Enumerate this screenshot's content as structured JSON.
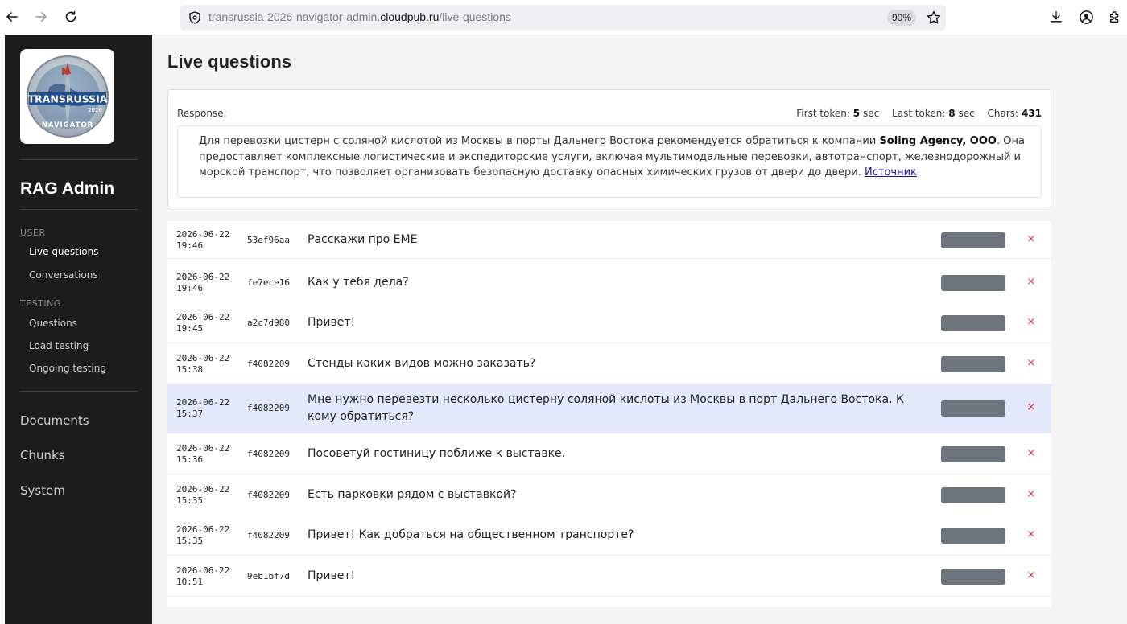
{
  "browser": {
    "url_prefix": "transrussia-2026-navigator-admin.",
    "url_host": "cloudpub.ru",
    "url_path": "/live-questions",
    "zoom": "90%"
  },
  "sidebar": {
    "brand": "RAG Admin",
    "logo_text": {
      "main": "TRANSRUSSIA",
      "year": "2026",
      "sub": "NAVIGATOR",
      "compass": "N"
    },
    "sections": [
      {
        "label": "USER",
        "items": [
          "Live questions",
          "Conversations"
        ]
      },
      {
        "label": "TESTING",
        "items": [
          "Questions",
          "Load testing",
          "Ongoing testing"
        ]
      }
    ],
    "main_items": [
      "Documents",
      "Chunks",
      "System"
    ]
  },
  "main": {
    "title": "Live questions",
    "response": {
      "label": "Response:",
      "first_token_label": "First token:",
      "first_token_value": "5",
      "last_token_label": "Last token:",
      "last_token_value": "8",
      "sec_unit": "sec",
      "chars_label": "Chars:",
      "chars_value": "431",
      "text_before": "Для перевозки цистерн с соляной кислотой из Москвы в порты Дальнего Востока рекомендуется обратиться к компании ",
      "company": "Soling Agency, ООО",
      "text_after": ". Она предоставляет комплексные логистические и экспедиторские услуги, включая мультимодальные перевозки, автотранспорт, железнодорожный и морской транспорт, что позволяет организовать безопасную доставку опасных химических грузов от двери до двери. ",
      "source_link": "Источник"
    },
    "questions": [
      {
        "date": "2026-06-22",
        "time": "19:46",
        "id": "53ef96aa",
        "text": "Расскажи про EME"
      },
      {
        "date": "2026-06-22",
        "time": "19:46",
        "id": "fe7ece16",
        "text": "Как у тебя дела?"
      },
      {
        "date": "2026-06-22",
        "time": "19:45",
        "id": "a2c7d980",
        "text": "Привет!"
      },
      {
        "date": "2026-06-22",
        "time": "15:38",
        "id": "f4082209",
        "text": "Стенды каких видов можно заказать?"
      },
      {
        "date": "2026-06-22",
        "time": "15:37",
        "id": "f4082209",
        "text": "Мне нужно перевезти несколько цистерну соляной кислоты из Москвы в порт Дальнего Востока. К кому обратиться?"
      },
      {
        "date": "2026-06-22",
        "time": "15:36",
        "id": "f4082209",
        "text": "Посоветуй гостиницу поближе к выставке."
      },
      {
        "date": "2026-06-22",
        "time": "15:35",
        "id": "f4082209",
        "text": "Есть парковки рядом с выставкой?"
      },
      {
        "date": "2026-06-22",
        "time": "15:35",
        "id": "f4082209",
        "text": "Привет! Как добраться на общественном транспорте?"
      },
      {
        "date": "2026-06-22",
        "time": "10:51",
        "id": "9eb1bf7d",
        "text": "Привет!"
      }
    ],
    "delete_glyph": "×"
  },
  "colors": {
    "sidebar_bg": "#1c1c1c",
    "main_bg": "#f4f4f4",
    "highlight_row": "#e3e9fb",
    "action_button": "#6c757d",
    "delete": "#dc3545",
    "link": "#1a0dab"
  },
  "icons": [
    "back-arrow-icon",
    "forward-arrow-icon",
    "reload-icon",
    "shield-icon",
    "star-icon",
    "download-icon",
    "account-icon",
    "extensions-icon",
    "close-icon"
  ]
}
